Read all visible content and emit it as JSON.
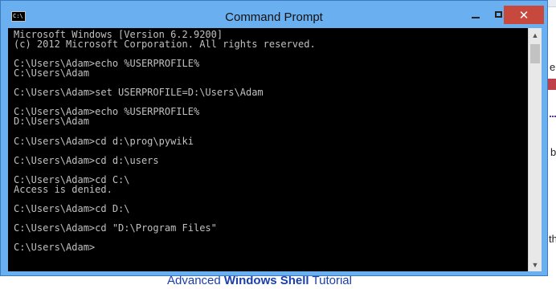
{
  "window": {
    "title": "Command Prompt",
    "icon_text": "C:\\",
    "controls": [
      "minimize-icon",
      "maximize-icon",
      "close-icon"
    ],
    "close_glyph": "✕"
  },
  "console": {
    "lines": [
      "Microsoft Windows [Version 6.2.9200]",
      "(c) 2012 Microsoft Corporation. All rights reserved.",
      "",
      "C:\\Users\\Adam>echo %USERPROFILE%",
      "C:\\Users\\Adam",
      "",
      "C:\\Users\\Adam>set USERPROFILE=D:\\Users\\Adam",
      "",
      "C:\\Users\\Adam>echo %USERPROFILE%",
      "D:\\Users\\Adam",
      "",
      "C:\\Users\\Adam>cd d:\\prog\\pywiki",
      "",
      "C:\\Users\\Adam>cd d:\\users",
      "",
      "C:\\Users\\Adam>cd C:\\",
      "Access is denied.",
      "",
      "C:\\Users\\Adam>cd D:\\",
      "",
      "C:\\Users\\Adam>cd \"D:\\Program Files\"",
      "",
      "C:\\Users\\Adam>"
    ]
  },
  "background_page": {
    "link_prefix": "Advanced ",
    "link_bold": "Windows Shell",
    "link_suffix": " Tutorial",
    "right_edge_fragments": [
      "e",
      "b",
      "th"
    ]
  },
  "colors": {
    "title_bar": "#6ab0f0",
    "close_button": "#c7483c",
    "console_bg": "#000000",
    "console_fg": "#c0c0c0",
    "link": "#1a3fa8"
  }
}
